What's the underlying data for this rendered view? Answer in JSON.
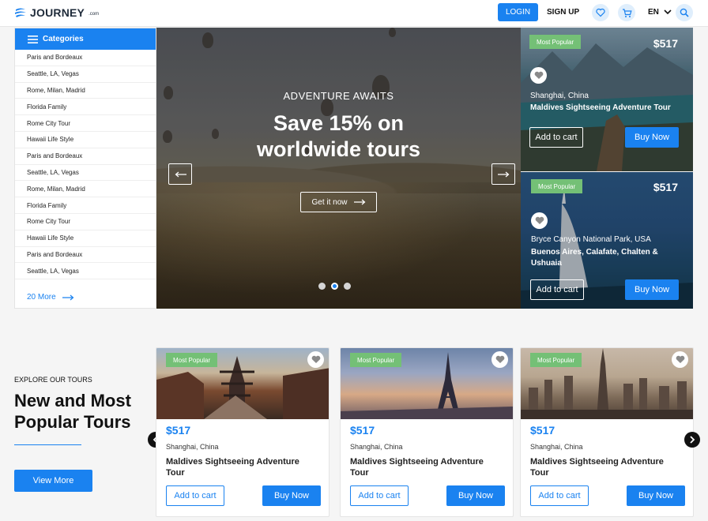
{
  "header": {
    "logo": "JOURNEY",
    "logo_sup": ".com",
    "login": "LOGIN",
    "signup": "SIGN UP",
    "language": "EN",
    "icons": [
      "heart-icon",
      "cart-icon",
      "chevron-down-icon",
      "search-icon"
    ]
  },
  "sidebar": {
    "title": "Categories",
    "items": [
      "Paris and Bordeaux",
      "Seattle, LA, Vegas",
      "Rome, Milan, Madrid",
      "Florida Family",
      "Rome City Tour",
      "Hawaii Life Style",
      "Paris and Bordeaux",
      "Seattle, LA, Vegas",
      "Rome, Milan, Madrid",
      "Florida Family",
      "Rome City Tour",
      "Hawaii Life Style",
      "Paris and Bordeaux",
      "Seattle, LA, Vegas"
    ],
    "more": "20 More"
  },
  "hero": {
    "kicker": "ADVENTURE AWAITS",
    "title_line1": "Save 15% on",
    "title_line2": "worldwide tours",
    "cta": "Get it now",
    "slides": 3,
    "active_slide": 2
  },
  "promos": [
    {
      "badge": "Most Popular",
      "price": "$517",
      "location": "Shanghai, China",
      "name": "Maldives Sightseeing Adventure Tour",
      "add_to_cart": "Add to cart",
      "buy": "Buy Now"
    },
    {
      "badge": "Most Popular",
      "price": "$517",
      "location": "Bryce Canyon National Park, USA",
      "name": "Buenos Aires, Calafate,  Chalten & Ushuaia",
      "add_to_cart": "Add to cart",
      "buy": "Buy Now"
    }
  ],
  "explore": {
    "kicker": "EXPLORE OUR TOURS",
    "title": "New and Most Popular Tours",
    "view_more": "View More"
  },
  "tours": [
    {
      "badge": "Most Popular",
      "price": "$517",
      "location": "Shanghai, China",
      "name": "Maldives Sightseeing Adventure Tour",
      "add_to_cart": "Add to cart",
      "buy": "Buy Now"
    },
    {
      "badge": "Most Popular",
      "price": "$517",
      "location": "Shanghai, China",
      "name": "Maldives Sightseeing Adventure Tour",
      "add_to_cart": "Add to cart",
      "buy": "Buy Now"
    },
    {
      "badge": "Most Popular",
      "price": "$517",
      "location": "Shanghai, China",
      "name": "Maldives Sightseeing Adventure Tour",
      "add_to_cart": "Add to cart",
      "buy": "Buy Now"
    }
  ],
  "colors": {
    "accent": "#1a82f0",
    "badge": "#74c076"
  }
}
